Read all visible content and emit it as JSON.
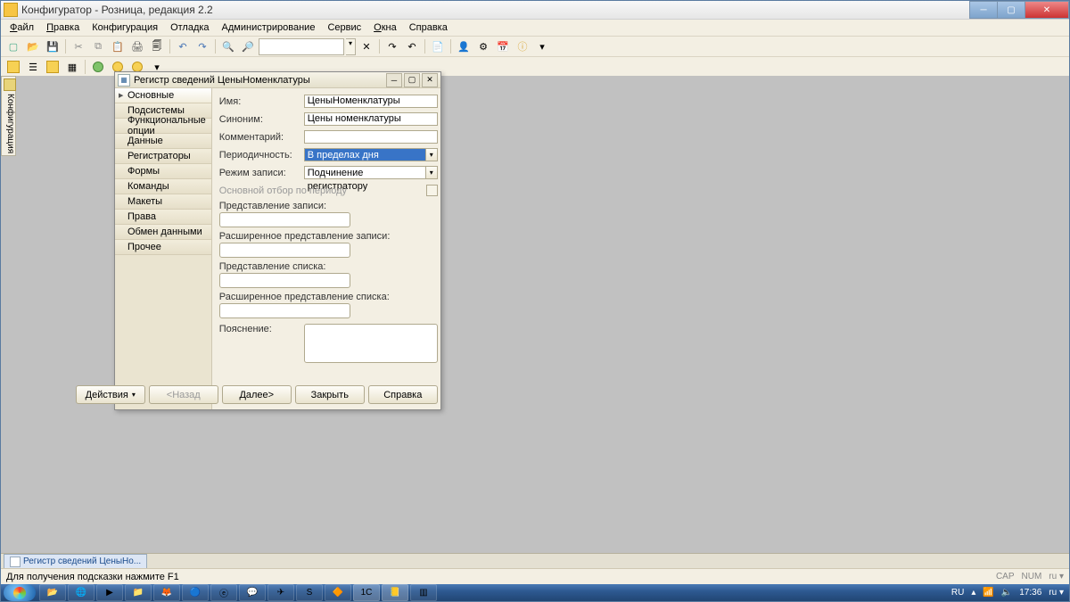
{
  "app": {
    "title": "Конфигуратор - Розница, редакция 2.2"
  },
  "menu": [
    "Файл",
    "Правка",
    "Конфигурация",
    "Отладка",
    "Администрирование",
    "Сервис",
    "Окна",
    "Справка"
  ],
  "sidetab": "Конфигурация",
  "dialog": {
    "title": "Регистр сведений ЦеныНоменклатуры",
    "nav": [
      "Основные",
      "Подсистемы",
      "Функциональные опции",
      "Данные",
      "Регистраторы",
      "Формы",
      "Команды",
      "Макеты",
      "Права",
      "Обмен данными",
      "Прочее"
    ],
    "nav_active": 0,
    "labels": {
      "name": "Имя:",
      "synonym": "Синоним:",
      "comment": "Комментарий:",
      "period": "Периодичность:",
      "writemode": "Режим записи:",
      "mainfilter": "Основной отбор по периоду",
      "recpres": "Представление записи:",
      "recpresext": "Расширенное представление записи:",
      "listpres": "Представление списка:",
      "listpresext": "Расширенное представление списка:",
      "explain": "Пояснение:"
    },
    "values": {
      "name": "ЦеныНоменклатуры",
      "synonym": "Цены номенклатуры",
      "comment": "",
      "period": "В пределах дня",
      "writemode": "Подчинение регистратору"
    },
    "buttons": {
      "actions": "Действия",
      "back": "<Назад",
      "next": "Далее>",
      "close": "Закрыть",
      "help": "Справка"
    }
  },
  "bottom_tab": "Регистр сведений ЦеныНо...",
  "status": {
    "hint": "Для получения подсказки нажмите F1",
    "cap": "CAP",
    "num": "NUM",
    "lang": "ru"
  },
  "tray": {
    "kb": "RU",
    "time": "17:36",
    "lang": "ru"
  }
}
